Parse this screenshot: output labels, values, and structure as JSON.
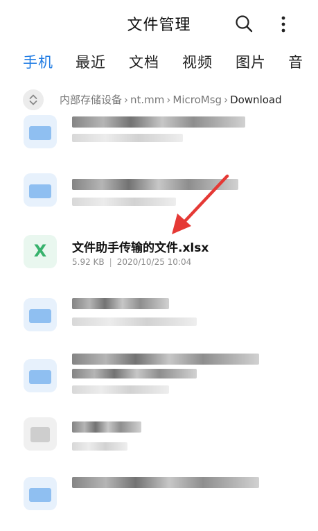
{
  "header": {
    "title": "文件管理"
  },
  "tabs": [
    {
      "label": "手机",
      "active": true
    },
    {
      "label": "最近"
    },
    {
      "label": "文档"
    },
    {
      "label": "视频"
    },
    {
      "label": "图片"
    },
    {
      "label": "音"
    }
  ],
  "breadcrumb": {
    "items": [
      "内部存储设备",
      "nt.mm",
      "MicroMsg"
    ],
    "current": "Download"
  },
  "file": {
    "name": "文件助手传输的文件.xlsx",
    "size": "5.92 KB",
    "date": "2020/10/25 10:04",
    "icon_letter": "X"
  },
  "colors": {
    "accent": "#1f7be3",
    "xlsx_green": "#37b26c",
    "annotation_arrow": "#e53935"
  },
  "icons": [
    "search-icon",
    "more-vert-icon",
    "expand-collapse-icon",
    "xlsx-file-icon",
    "red-annotation-arrow"
  ]
}
